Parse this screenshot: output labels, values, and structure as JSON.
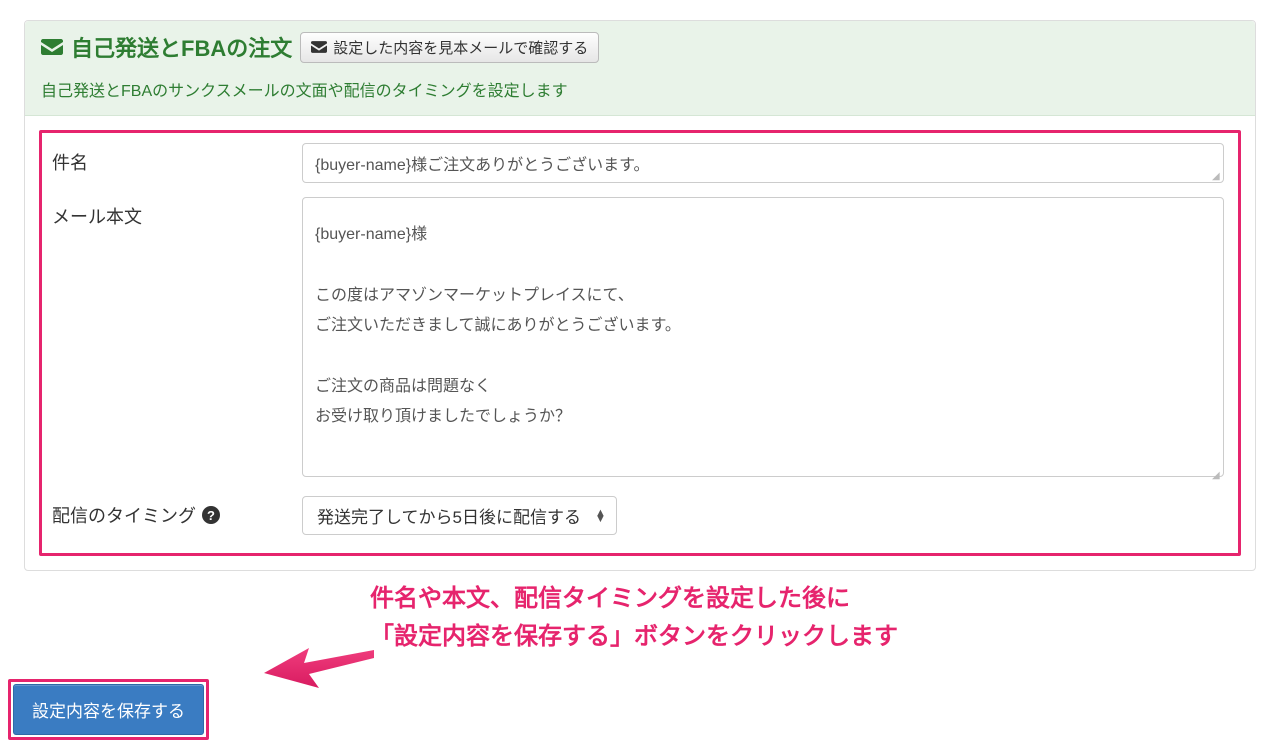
{
  "panel": {
    "title": "自己発送とFBAの注文",
    "confirm_button": "設定した内容を見本メールで確認する",
    "subtitle": "自己発送とFBAのサンクスメールの文面や配信のタイミングを設定します"
  },
  "form": {
    "subject_label": "件名",
    "subject_value": "{buyer-name}様ご注文ありがとうございます。",
    "body_label": "メール本文",
    "body_value": "{buyer-name}様\n\nこの度はアマゾンマーケットプレイスにて、\nご注文いただきまして誠にありがとうございます。\n\nご注文の商品は問題なく\nお受け取り頂けましたでしょうか？",
    "timing_label": "配信のタイミング",
    "timing_value": "発送完了してから5日後に配信する"
  },
  "instruction": {
    "line1": "件名や本文、配信タイミングを設定した後に",
    "line2": "「設定内容を保存する」ボタンをクリックします"
  },
  "save_button": "設定内容を保存する"
}
